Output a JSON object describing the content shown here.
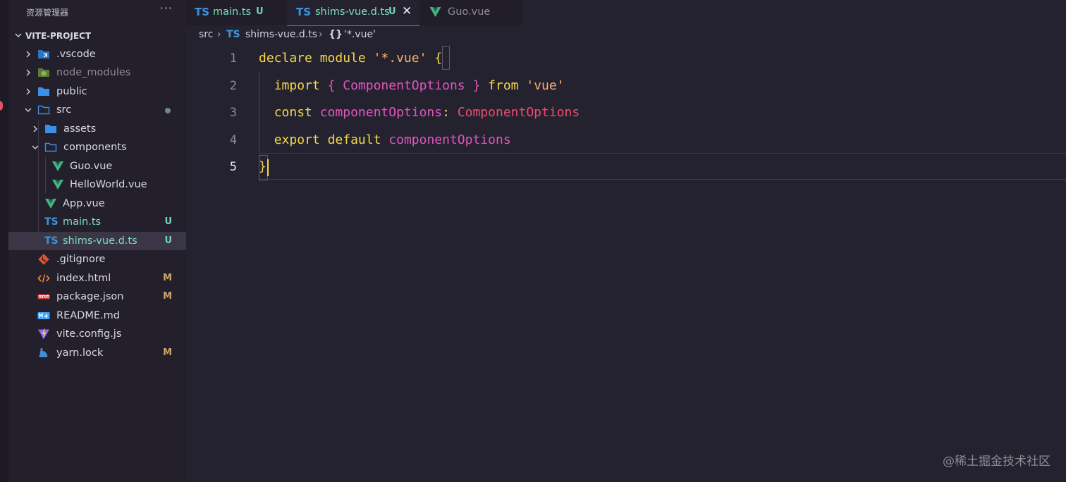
{
  "sidebar": {
    "title": "资源管理器",
    "more": "···",
    "project": "VITE-PROJECT",
    "items": [
      {
        "name": ".vscode",
        "status": ""
      },
      {
        "name": "node_modules",
        "status": ""
      },
      {
        "name": "public",
        "status": ""
      },
      {
        "name": "src",
        "status": ""
      },
      {
        "name": "assets",
        "status": ""
      },
      {
        "name": "components",
        "status": ""
      },
      {
        "name": "Guo.vue",
        "status": ""
      },
      {
        "name": "HelloWorld.vue",
        "status": ""
      },
      {
        "name": "App.vue",
        "status": ""
      },
      {
        "name": "main.ts",
        "status": "U"
      },
      {
        "name": "shims-vue.d.ts",
        "status": "U"
      },
      {
        "name": ".gitignore",
        "status": ""
      },
      {
        "name": "index.html",
        "status": "M"
      },
      {
        "name": "package.json",
        "status": "M"
      },
      {
        "name": "README.md",
        "status": ""
      },
      {
        "name": "vite.config.js",
        "status": ""
      },
      {
        "name": "yarn.lock",
        "status": "M"
      }
    ]
  },
  "tabs": [
    {
      "icon": "TS",
      "label": "main.ts",
      "status": "U"
    },
    {
      "icon": "TS",
      "label": "shims-vue.d.ts",
      "status": "U",
      "close": "✕"
    },
    {
      "label": "Guo.vue"
    }
  ],
  "breadcrumb": {
    "folder": "src",
    "file_icon": "TS",
    "file": "shims-vue.d.ts",
    "symbol_icon": "{}",
    "symbol": "'*.vue'"
  },
  "editor": {
    "line_numbers": [
      "1",
      "2",
      "3",
      "4",
      "5"
    ],
    "line1": {
      "a": "declare",
      "b": "module",
      "c": "'*.vue'",
      "d": "{"
    },
    "line2": {
      "a": "import",
      "b": "{",
      "c": "ComponentOptions",
      "d": "}",
      "e": "from",
      "f": "'vue'"
    },
    "line3": {
      "a": "const",
      "b": "componentOptions",
      "c": ":",
      "d": "ComponentOptions"
    },
    "line4": {
      "a": "export",
      "b": "default",
      "c": "componentOptions"
    },
    "line5": {
      "a": "}"
    }
  },
  "watermark": "@稀土掘金技术社区",
  "colors": {
    "keyword": "#f4d94c",
    "string": "#fbae6d",
    "identifier": "#e255c2",
    "type": "#f54a6a",
    "background": "#25222f"
  }
}
